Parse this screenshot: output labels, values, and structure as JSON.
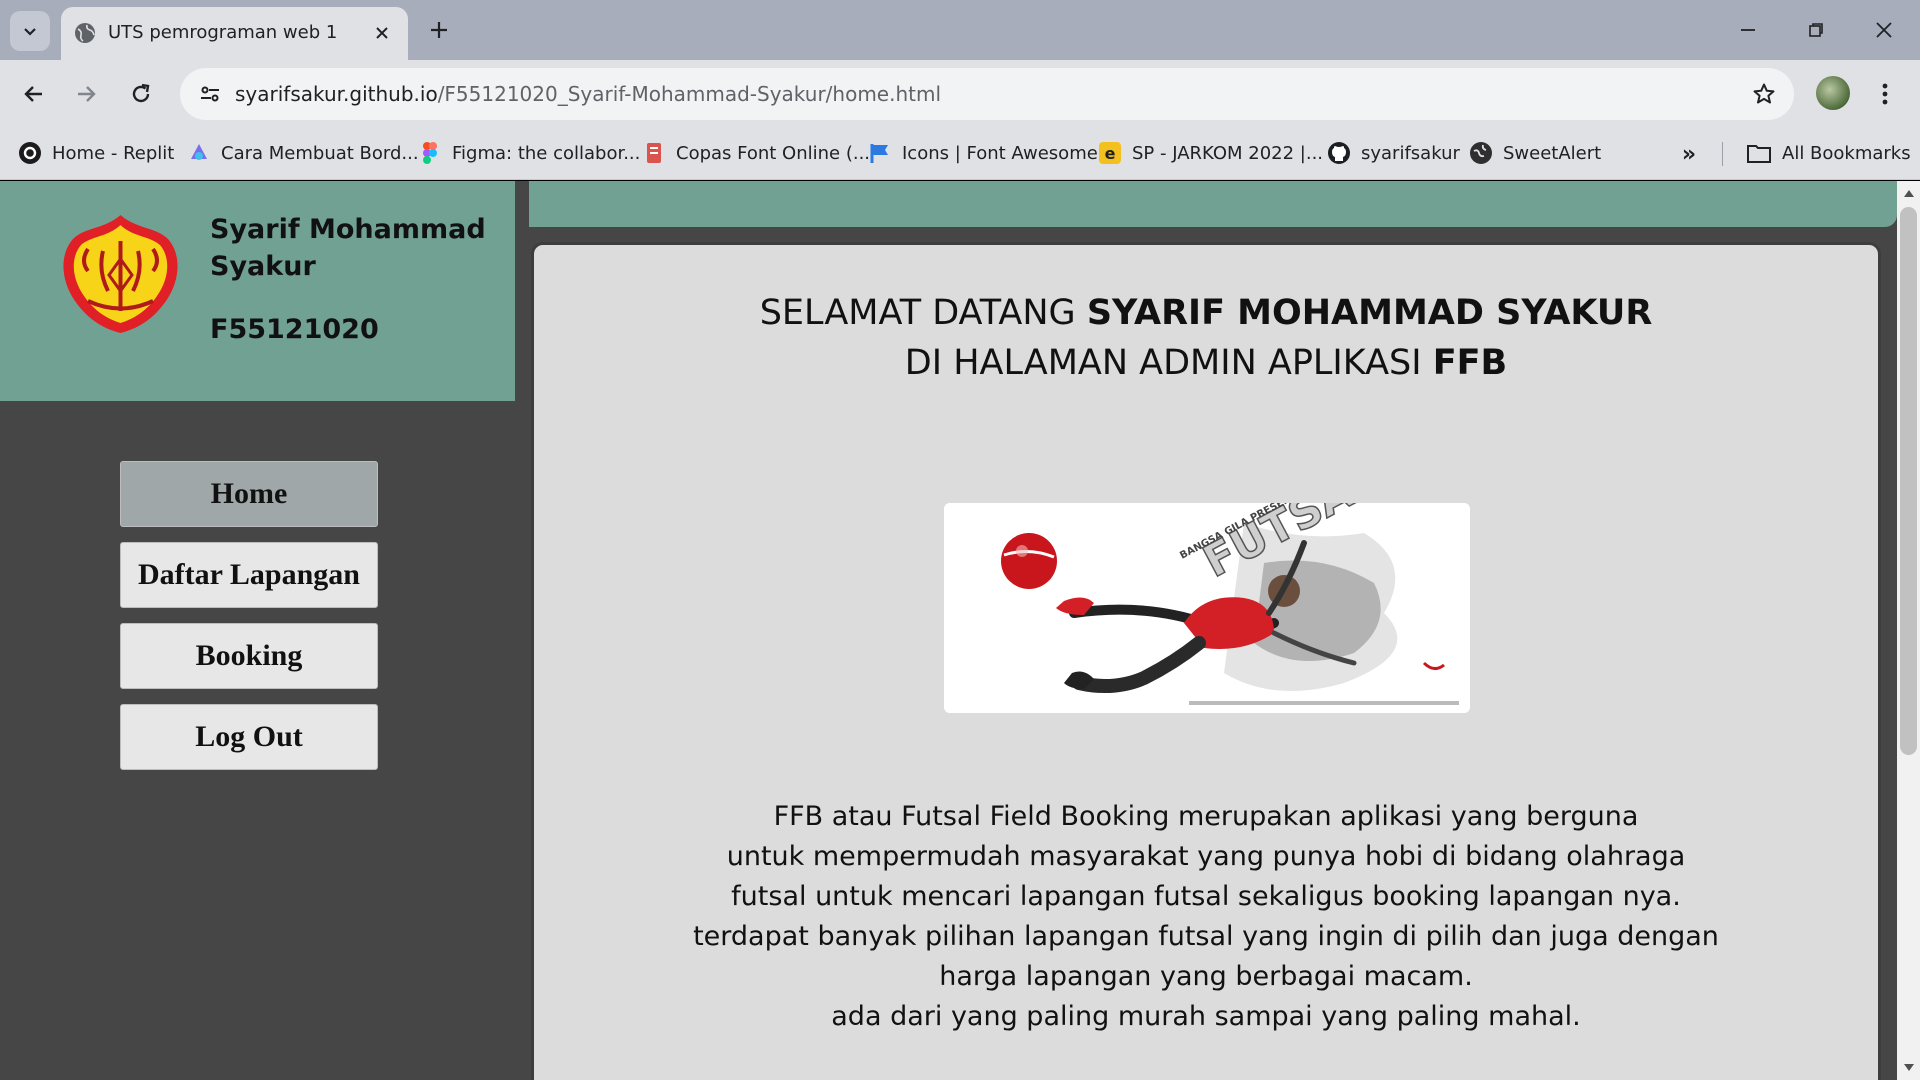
{
  "browser": {
    "tab_title": "UTS pemrograman web 1",
    "url_host": "syarifsakur.github.io",
    "url_path": "/F55121020_Syarif-Mohammad-Syakur/home.html",
    "bookmarks": [
      {
        "label": "Home - Replit",
        "icon": "replit-icon",
        "color": "#1c1c1c"
      },
      {
        "label": "Cara Membuat Bord...",
        "icon": "bord-icon",
        "color": "#7b6cf0"
      },
      {
        "label": "Figma: the collabor...",
        "icon": "figma-icon",
        "color": "#f24e1e"
      },
      {
        "label": "Copas Font Online (...",
        "icon": "copas-icon",
        "color": "#d9534f"
      },
      {
        "label": "Icons | Font Awesome",
        "icon": "font-awesome-icon",
        "color": "#2a7ae2"
      },
      {
        "label": "SP - JARKOM 2022 |...",
        "icon": "elearning-icon",
        "color": "#f4c01e"
      },
      {
        "label": "syarifsakur",
        "icon": "github-icon",
        "color": "#1b1f23"
      },
      {
        "label": "SweetAlert",
        "icon": "sweetalert-icon",
        "color": "#2f2f2f"
      }
    ],
    "all_bookmarks": "All Bookmarks"
  },
  "profile": {
    "name": "Syarif Mohammad Syakur",
    "nim": "F55121020"
  },
  "nav": {
    "home": "Home",
    "daftar": "Daftar Lapangan",
    "booking": "Booking",
    "logout": "Log Out"
  },
  "welcome": {
    "line1_prefix": "SELAMAT DATANG ",
    "line1_name": "SYARIF MOHAMMAD SYAKUR",
    "line2_prefix": "DI HALAMAN ADMIN APLIKASI ",
    "line2_app": "FFB"
  },
  "hero": {
    "caption": "FUTSAL",
    "subtitle": "BANGSA GILA PRESENT"
  },
  "description": [
    "FFB atau Futsal Field Booking merupakan aplikasi yang berguna",
    "untuk mempermudah masyarakat yang punya hobi di bidang olahraga",
    "futsal untuk mencari lapangan futsal sekaligus booking lapangan nya.",
    "terdapat banyak pilihan lapangan futsal yang ingin di pilih dan juga dengan",
    "harga lapangan yang berbagai macam.",
    "ada dari yang paling murah sampai yang paling mahal."
  ],
  "colors": {
    "sidebar_header": "#71a193",
    "sidebar": "#464646",
    "panel": "#dcdcdd",
    "active_nav": "#9fa7a8"
  }
}
